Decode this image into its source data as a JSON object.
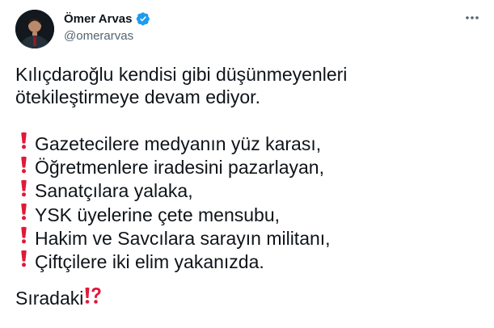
{
  "author": {
    "name": "Ömer Arvas",
    "handle": "@omerarvas"
  },
  "icons": {
    "verified": "verified-badge-icon",
    "more": "more-options-icon",
    "exclamation": "red-exclamation-emoji",
    "interrobang": "red-exclamation-question-emoji"
  },
  "colors": {
    "verified": "#1d9bf0",
    "handle": "#536471",
    "text": "#0f1419",
    "emoji_red": "#e0193a"
  },
  "tweet": {
    "intro_line1": "Kılıçdaroğlu kendisi gibi düşünmeyenleri",
    "intro_line2": "ötekileştirmeye devam ediyor.",
    "list": [
      "Gazetecilere medyanın yüz karası,",
      "Öğretmenlere iradesini pazarlayan,",
      "Sanatçılara yalaka,",
      "YSK üyelerine çete mensubu,",
      "Hakim ve Savcılara sarayın militanı,",
      "Çiftçilere iki elim yakanızda."
    ],
    "closing": "Sıradaki"
  }
}
